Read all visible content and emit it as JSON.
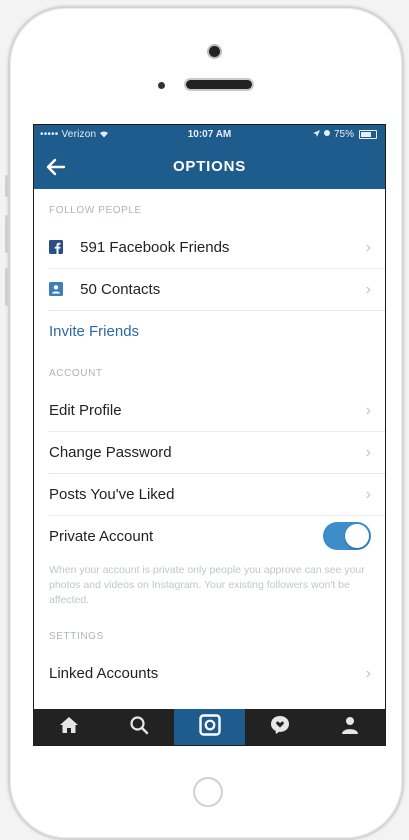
{
  "status_bar": {
    "carrier": "••••• Verizon",
    "time": "10:07 AM",
    "battery": "75%"
  },
  "nav": {
    "title": "OPTIONS"
  },
  "sections": {
    "follow_people": {
      "header": "FOLLOW PEOPLE",
      "facebook_friends": "591 Facebook Friends",
      "contacts": "50 Contacts",
      "invite_friends": "Invite Friends"
    },
    "account": {
      "header": "ACCOUNT",
      "edit_profile": "Edit Profile",
      "change_password": "Change Password",
      "posts_liked": "Posts You've Liked",
      "private_account": "Private Account",
      "private_account_on": true,
      "private_hint": "When your account is private only people you approve can see your photos and videos on Instagram. Your existing followers won't be affected."
    },
    "settings": {
      "header": "SETTINGS",
      "linked_accounts": "Linked Accounts"
    }
  },
  "colors": {
    "brand_blue": "#1f5c8e",
    "link_blue": "#2d6aa3",
    "toggle_on": "#3c8dc9",
    "tabbar_bg": "#222222"
  },
  "tabs": [
    {
      "icon": "home-icon",
      "active": false
    },
    {
      "icon": "search-icon",
      "active": false
    },
    {
      "icon": "camera-icon",
      "active": true
    },
    {
      "icon": "activity-icon",
      "active": false
    },
    {
      "icon": "profile-icon",
      "active": false
    }
  ]
}
